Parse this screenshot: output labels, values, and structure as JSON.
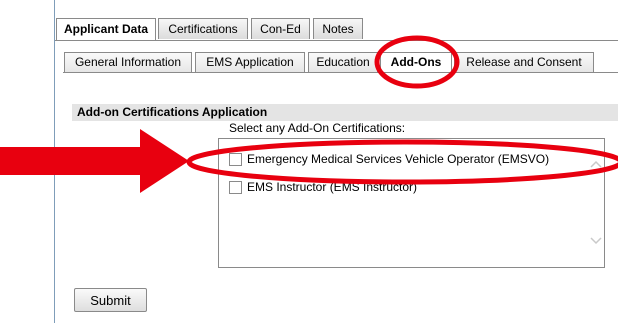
{
  "tabs_top": [
    "Applicant Data",
    "Certifications",
    "Con-Ed",
    "Notes"
  ],
  "tabs_sub": [
    "General Information",
    "EMS Application",
    "Education",
    "Add-Ons",
    "Release and Consent"
  ],
  "section": {
    "title": "Add-on Certifications Application",
    "prompt": "Select any Add-On Certifications:"
  },
  "options": [
    {
      "label": "Emergency Medical Services Vehicle Operator (EMSVO)",
      "checked": false
    },
    {
      "label": "EMS Instructor (EMS Instructor)",
      "checked": false
    }
  ],
  "submit_label": "Submit",
  "annotation_color": "#e8000f"
}
